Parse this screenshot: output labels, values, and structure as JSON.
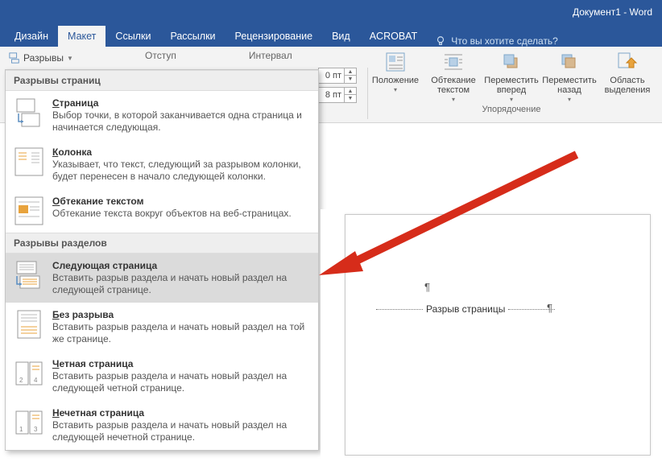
{
  "title": "Документ1 - Word",
  "tabs": {
    "design": "Дизайн",
    "layout": "Макет",
    "links": "Ссылки",
    "mailings": "Рассылки",
    "review": "Рецензирование",
    "view": "Вид",
    "acrobat": "ACROBAT",
    "tellme": "Что вы хотите сделать?"
  },
  "ribbon": {
    "breaks_button": "Разрывы",
    "indent_label": "Отступ",
    "spacing_label": "Интервал",
    "spin_before": "0 пт",
    "spin_after": "8 пт",
    "arrange": {
      "position": "Положение",
      "wrap": "Обтекание текстом",
      "forward": "Переместить вперед",
      "backward": "Переместить назад",
      "selection": "Область выделения",
      "group_caption": "Упорядочение"
    }
  },
  "gallery": {
    "header_pages": "Разрывы страниц",
    "header_sections": "Разрывы разделов",
    "items": {
      "page": {
        "title": "Страница",
        "desc": "Выбор точки, в которой заканчивается одна страница и начинается следующая."
      },
      "column": {
        "title": "Колонка",
        "desc": "Указывает, что текст, следующий за разрывом колонки, будет перенесен в начало следующей колонки."
      },
      "textwrap": {
        "title": "Обтекание текстом",
        "desc": "Обтекание текста вокруг объектов на веб-страницах."
      },
      "nextpage": {
        "title": "Следующая страница",
        "desc": "Вставить разрыв раздела и начать новый раздел на следующей странице."
      },
      "continuous": {
        "title": "Без разрыва",
        "desc": "Вставить разрыв раздела и начать новый раздел на той же странице."
      },
      "even": {
        "title": "Четная страница",
        "desc": "Вставить разрыв раздела и начать новый раздел на следующей четной странице."
      },
      "odd": {
        "title": "Нечетная страница",
        "desc": "Вставить разрыв раздела и начать новый раздел на следующей нечетной странице."
      }
    }
  },
  "document": {
    "pilcrow": "¶",
    "break_label": "Разрыв страницы",
    "pilcrow2": "¶"
  }
}
